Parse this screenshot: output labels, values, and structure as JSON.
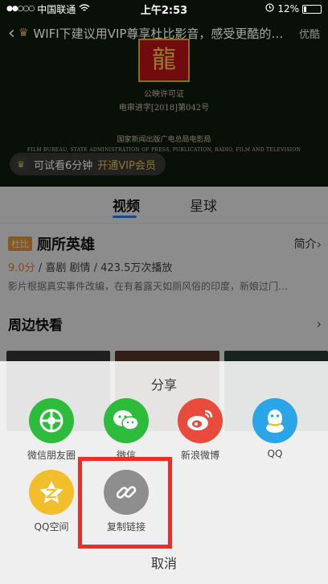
{
  "status": {
    "carrier": "中国联通",
    "time": "上午2:53",
    "battery": "12%",
    "signal_dots": "●●○○○"
  },
  "player": {
    "title": "WIFI下建议用VIP尊享杜比影音，感受更酷的…",
    "quality": "优酷",
    "license_line1": "公映许可证",
    "license_line2": "电审进字[2018]第042号",
    "license_line3": "国家新闻出版广电总局电影局",
    "license_line4": "FILM BUREAU, STATE ADMINISTRATION OF PRESS, PUBLICATION, RADIO, FILM AND TELEVISION",
    "trial_text": "可试看6分钟",
    "trial_link": "开通VIP会员"
  },
  "tabs": [
    "视频",
    "星球"
  ],
  "movie": {
    "badge": "杜比",
    "title": "厕所英雄",
    "intro": "简介",
    "score": "9.0分",
    "genres": "喜剧 剧情",
    "plays": "423.5万次播放",
    "desc": "影片根据真实事件改编，在有着露天如厕风俗的印度，新娘过门…"
  },
  "nearby": {
    "title": "周边快看"
  },
  "share": {
    "title": "分享",
    "items": [
      {
        "label": "微信朋友圈",
        "color": "#2dbb3b",
        "icon": "moments-icon"
      },
      {
        "label": "微信",
        "color": "#2dbb3b",
        "icon": "wechat-icon"
      },
      {
        "label": "新浪微博",
        "color": "#e84b3c",
        "icon": "weibo-icon"
      },
      {
        "label": "QQ",
        "color": "#2aa5e8",
        "icon": "qq-icon"
      },
      {
        "label": "QQ空间",
        "color": "#f2be2b",
        "icon": "qzone-icon"
      },
      {
        "label": "复制链接",
        "color": "#8e8e8e",
        "icon": "link-icon"
      }
    ],
    "cancel": "取消"
  },
  "colors": {
    "accent_blue": "#2b8cf5",
    "highlight_red": "#ef2b2b",
    "vip_gold": "#d9b55b"
  }
}
